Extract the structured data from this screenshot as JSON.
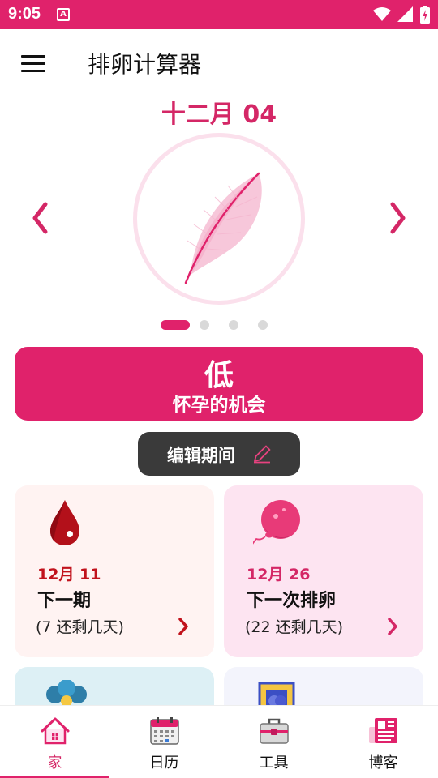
{
  "status_bar": {
    "time": "9:05",
    "notification_icon_text": "A",
    "icons": [
      "wifi-icon",
      "signal-icon",
      "battery-charging-icon"
    ]
  },
  "app_bar": {
    "title": "排卵计算器",
    "menu_icon": "hamburger-menu-icon"
  },
  "date_label": "十二月 04",
  "carousel": {
    "image": "feather-illustration",
    "page_count": 4,
    "active_page": 1
  },
  "chance": {
    "level": "低",
    "text": "怀孕的机会"
  },
  "edit_button": {
    "label": "编辑期间",
    "icon": "pencil-icon"
  },
  "cards": [
    {
      "icon": "blood-drop-icon",
      "date": "12月 11",
      "title": "下一期",
      "subtitle": "(7 还剩几天)"
    },
    {
      "icon": "egg-cell-icon",
      "date": "12月 26",
      "title": "下一次排卵",
      "subtitle": "(22 还剩几天)"
    }
  ],
  "partial_cards": [
    "flower-icon",
    "shield-icon"
  ],
  "bottom_nav": {
    "active": "home",
    "items": [
      {
        "id": "home",
        "label": "家",
        "icon": "home-icon"
      },
      {
        "id": "calendar",
        "label": "日历",
        "icon": "calendar-icon"
      },
      {
        "id": "tools",
        "label": "工具",
        "icon": "toolbox-icon"
      },
      {
        "id": "blog",
        "label": "博客",
        "icon": "newspaper-icon"
      }
    ]
  },
  "colors": {
    "primary": "#e0226b",
    "primary_text": "#d42766",
    "period_red": "#c1121c",
    "period_card_bg": "#fff3f2",
    "ovulation_card_bg": "#fde4f1",
    "edit_button_bg": "#3a3a3a"
  }
}
